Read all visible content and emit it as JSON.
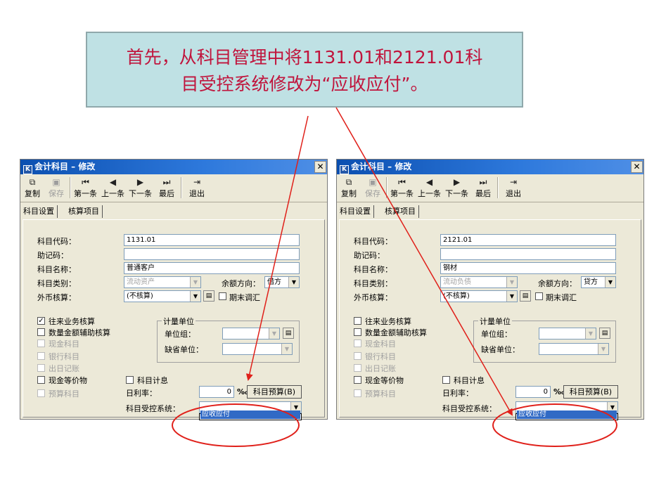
{
  "callout": {
    "line1": "首先，从科目管理中将1131.01和2121.01科",
    "line2": "目受控系统修改为“应收应付”。"
  },
  "windows": [
    {
      "title": "会计科目 – 修改",
      "toolbar": {
        "copy": "复制",
        "save": "保存",
        "first": "第一条",
        "prev": "上一条",
        "next": "下一条",
        "last": "最后",
        "exit": "退出"
      },
      "tabs": [
        "科目设置",
        "核算项目"
      ],
      "labels": {
        "code": "科目代码：",
        "mnemonic": "助记码：",
        "name": "科目名称：",
        "category": "科目类别：",
        "currency": "外币核算：",
        "balance_dir": "余额方向：",
        "period_end": "期末调汇",
        "unit_group_title": "计量单位",
        "unit_group": "单位组：",
        "default_unit": "缺省单位：",
        "interest": "科目计息",
        "daily_rate": "日利率：",
        "budget": "科目预算(B)",
        "controlled": "科目受控系统："
      },
      "values": {
        "code": "1131.01",
        "mnemonic": "",
        "name": "普通客户",
        "category": "流动资产",
        "currency": "(不核算)",
        "balance_dir": "借方",
        "rate": "0",
        "rate_unit": "‰"
      },
      "checks": [
        {
          "label": "往来业务核算",
          "checked": true,
          "disabled": false
        },
        {
          "label": "数量金额辅助核算",
          "checked": false,
          "disabled": false
        },
        {
          "label": "现金科目",
          "checked": false,
          "disabled": true
        },
        {
          "label": "银行科目",
          "checked": false,
          "disabled": true
        },
        {
          "label": "出日记账",
          "checked": false,
          "disabled": true
        },
        {
          "label": "现金等价物",
          "checked": false,
          "disabled": false
        },
        {
          "label": "预算科目",
          "checked": false,
          "disabled": true
        }
      ],
      "dropdown_option": "应收应付"
    },
    {
      "title": "会计科目 – 修改",
      "toolbar": {
        "copy": "复制",
        "save": "保存",
        "first": "第一条",
        "prev": "上一条",
        "next": "下一条",
        "last": "最后",
        "exit": "退出"
      },
      "tabs": [
        "科目设置",
        "核算项目"
      ],
      "labels": {
        "code": "科目代码：",
        "mnemonic": "助记码：",
        "name": "科目名称：",
        "category": "科目类别：",
        "currency": "外币核算：",
        "balance_dir": "余额方向：",
        "period_end": "期末调汇",
        "unit_group_title": "计量单位",
        "unit_group": "单位组：",
        "default_unit": "缺省单位：",
        "interest": "科目计息",
        "daily_rate": "日利率：",
        "budget": "科目预算(B)",
        "controlled": "科目受控系统："
      },
      "values": {
        "code": "2121.01",
        "mnemonic": "",
        "name": "钢材",
        "category": "流动负债",
        "currency": "(不核算)",
        "balance_dir": "贷方",
        "rate": "0",
        "rate_unit": "‰"
      },
      "checks": [
        {
          "label": "往来业务核算",
          "checked": false,
          "disabled": false
        },
        {
          "label": "数量金额辅助核算",
          "checked": false,
          "disabled": false
        },
        {
          "label": "现金科目",
          "checked": false,
          "disabled": true
        },
        {
          "label": "银行科目",
          "checked": false,
          "disabled": true
        },
        {
          "label": "出日记账",
          "checked": false,
          "disabled": true
        },
        {
          "label": "现金等价物",
          "checked": false,
          "disabled": false
        },
        {
          "label": "预算科目",
          "checked": false,
          "disabled": true
        }
      ],
      "dropdown_option": "应收应付"
    }
  ],
  "colors": {
    "callout_bg": "#bfe1e4",
    "callout_text": "#c0143c",
    "annotation_red": "#e0201a",
    "selection_blue": "#316ac5"
  }
}
